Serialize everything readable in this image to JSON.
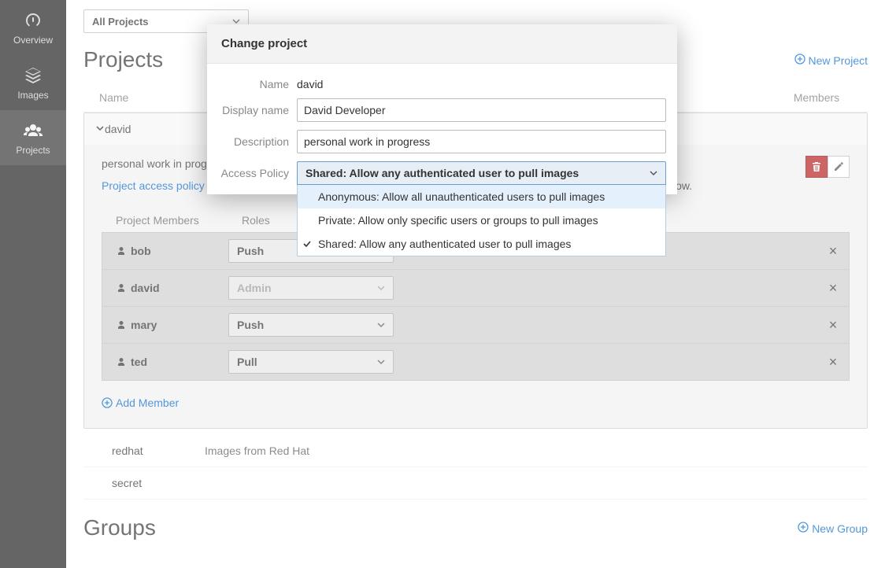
{
  "sidebar": {
    "items": [
      {
        "label": "Overview"
      },
      {
        "label": "Images"
      },
      {
        "label": "Projects"
      }
    ]
  },
  "filter": {
    "selected": "All Projects"
  },
  "sections": {
    "projects": "Projects",
    "groups": "Groups",
    "new_project": "New Project",
    "new_group": "New Group"
  },
  "columns": {
    "name": "Name",
    "members_hdr": "Members"
  },
  "project": {
    "name": "david",
    "description": "personal work in progress",
    "policy_link": "Project access policy",
    "policy_tail": " allows any authenticated user to pull images. Grant additional access to users and members below.",
    "members_hdr": "Project Members",
    "roles_hdr": "Roles",
    "add_member": "Add Member",
    "members": [
      {
        "name": "bob",
        "role": "Push"
      },
      {
        "name": "david",
        "role": "Admin"
      },
      {
        "name": "mary",
        "role": "Push"
      },
      {
        "name": "ted",
        "role": "Pull"
      }
    ]
  },
  "other_projects": [
    {
      "name": "redhat",
      "description": "Images from Red Hat"
    },
    {
      "name": "secret",
      "description": ""
    }
  ],
  "modal": {
    "title": "Change project",
    "labels": {
      "name": "Name",
      "display_name": "Display name",
      "description": "Description",
      "access_policy": "Access Policy"
    },
    "values": {
      "name": "david",
      "display_name": "David Developer",
      "description": "personal work in progress"
    },
    "access": {
      "selected": "Shared: Allow any authenticated user to pull images",
      "options": [
        "Anonymous: Allow all unauthenticated users to pull images",
        "Private: Allow only specific users or groups to pull images",
        "Shared: Allow any authenticated user to pull images"
      ],
      "selected_index": 2,
      "hover_index": 0
    }
  }
}
